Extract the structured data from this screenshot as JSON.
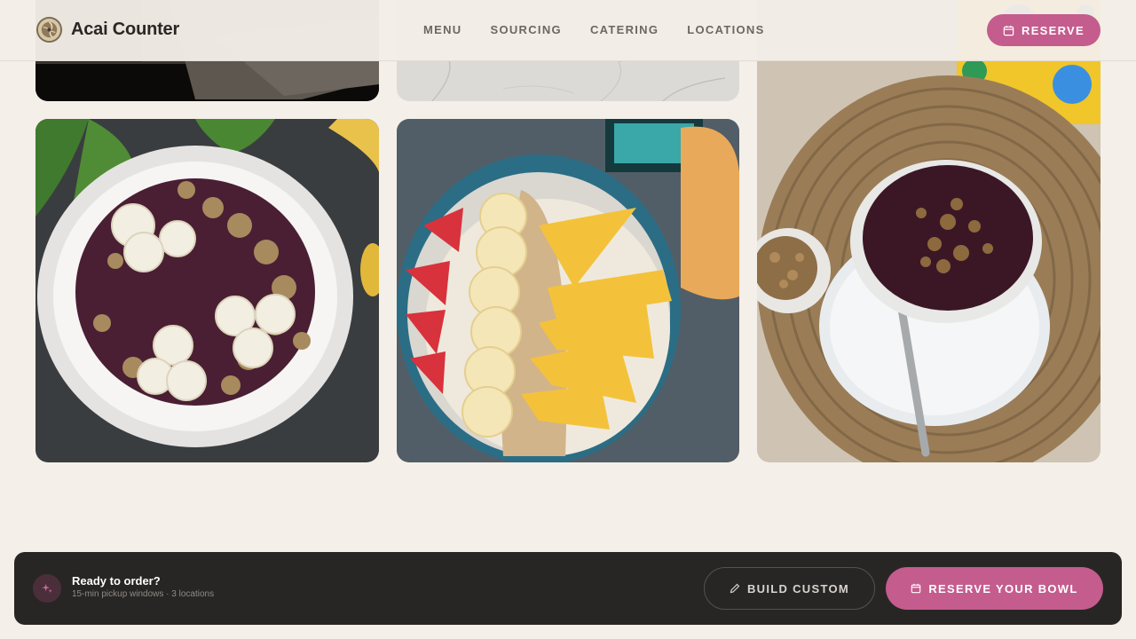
{
  "brand": {
    "name": "Acai Counter",
    "logo_icon": "acai-bowl-logo"
  },
  "nav": {
    "items": [
      {
        "label": "MENU"
      },
      {
        "label": "SOURCING"
      },
      {
        "label": "CATERING"
      },
      {
        "label": "LOCATIONS"
      }
    ]
  },
  "header": {
    "reserve_label": "RESERVE",
    "reserve_icon": "calendar-icon"
  },
  "gallery": {
    "images": [
      {
        "subject": "acai-bowl-dark-tray"
      },
      {
        "subject": "acai-bowl-marble-counter"
      },
      {
        "subject": "acai-bowl-granola-on-woven-placemat"
      },
      {
        "subject": "acai-bowl-banana-granola"
      },
      {
        "subject": "smoothie-bowl-strawberry-banana-mango"
      }
    ]
  },
  "cta": {
    "icon": "sparkle-icon",
    "title": "Ready to order?",
    "subtitle": "15-min pickup windows · 3 locations",
    "build_label": "BUILD CUSTOM",
    "build_icon": "pencil-icon",
    "reserve_label": "RESERVE YOUR BOWL",
    "reserve_icon": "calendar-icon"
  },
  "colors": {
    "accent": "#c45c8e",
    "background": "#f4efe8",
    "cta_bar": "#282624",
    "text_dark": "#2a2624"
  }
}
